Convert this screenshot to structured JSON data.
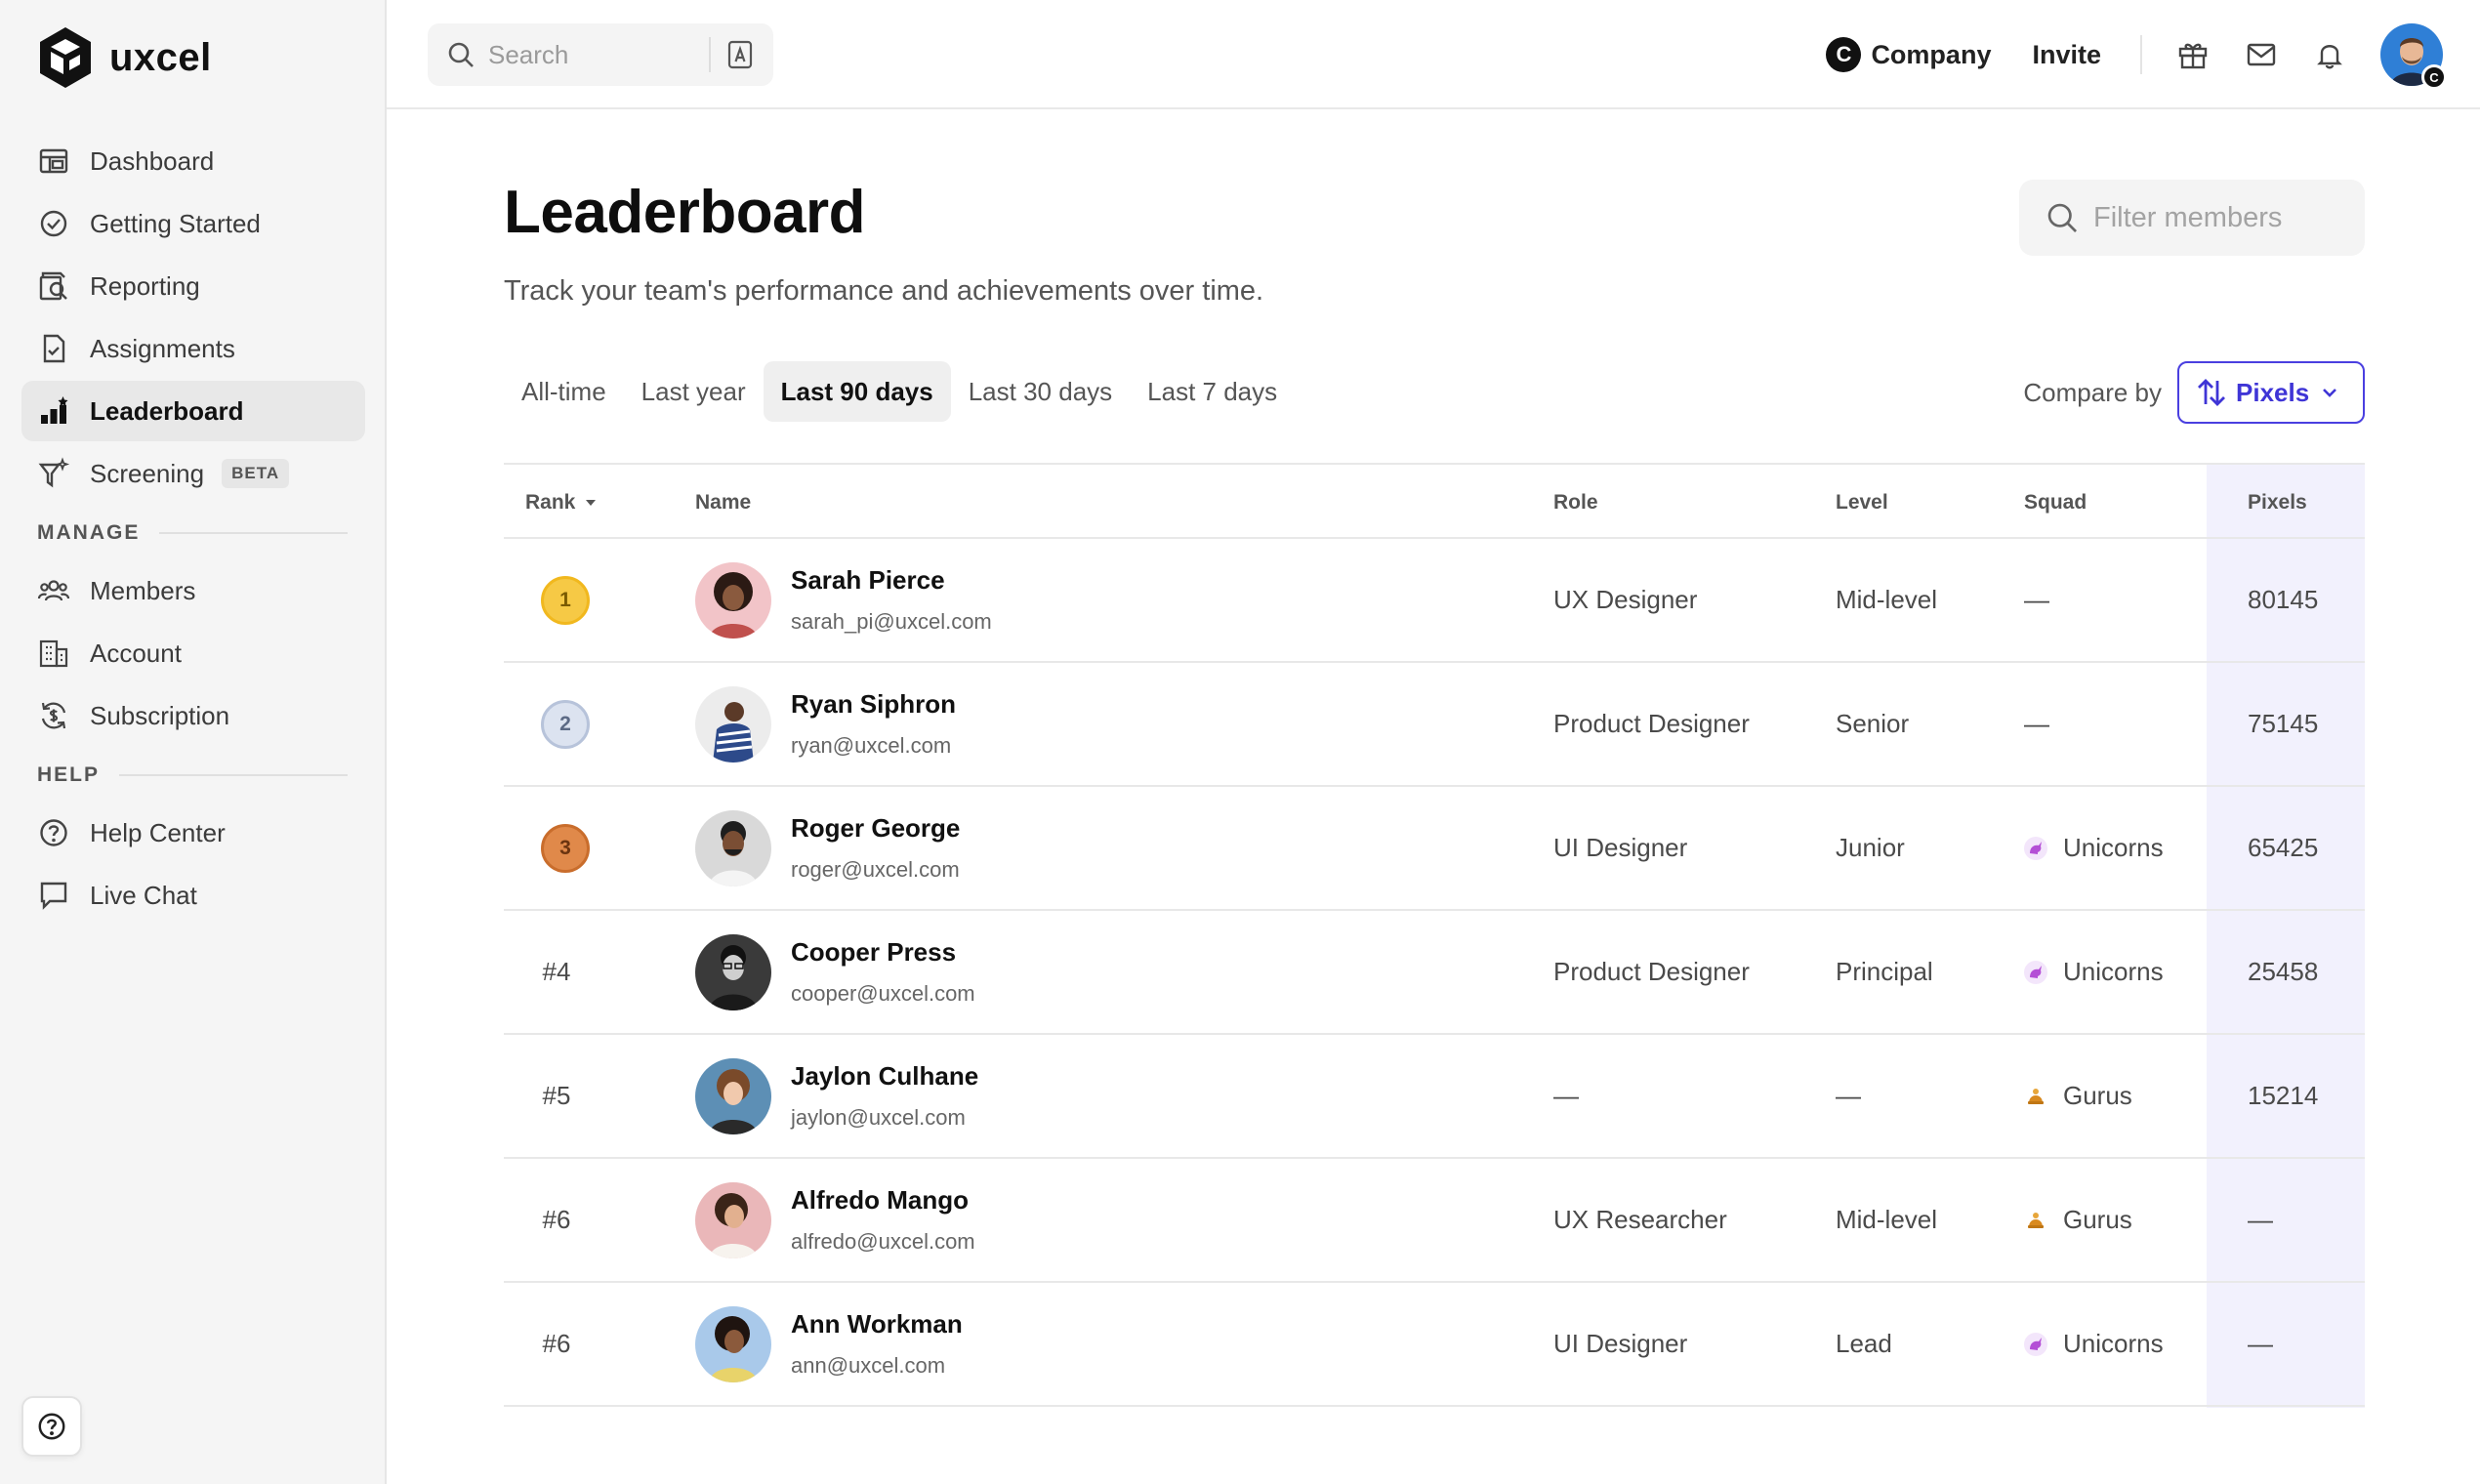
{
  "brand": {
    "name": "uxcel"
  },
  "sidebar": {
    "items": [
      {
        "label": "Dashboard",
        "icon": "dashboard-icon"
      },
      {
        "label": "Getting Started",
        "icon": "check-circle-icon"
      },
      {
        "label": "Reporting",
        "icon": "reporting-icon"
      },
      {
        "label": "Assignments",
        "icon": "assignment-icon"
      },
      {
        "label": "Leaderboard",
        "icon": "leaderboard-icon",
        "active": true
      },
      {
        "label": "Screening",
        "icon": "screening-icon",
        "badge": "BETA"
      }
    ],
    "manage_label": "MANAGE",
    "manage_items": [
      {
        "label": "Members",
        "icon": "members-icon"
      },
      {
        "label": "Account",
        "icon": "building-icon"
      },
      {
        "label": "Subscription",
        "icon": "subscription-icon"
      }
    ],
    "help_label": "HELP",
    "help_items": [
      {
        "label": "Help Center",
        "icon": "help-circle-icon"
      },
      {
        "label": "Live Chat",
        "icon": "chat-icon"
      }
    ]
  },
  "topbar": {
    "search_placeholder": "Search",
    "company_label": "Company",
    "company_initial": "C",
    "invite_label": "Invite",
    "avatar_badge": "C"
  },
  "page": {
    "title": "Leaderboard",
    "subtitle": "Track your team's performance and achievements over time.",
    "filter_placeholder": "Filter members",
    "tabs": [
      "All-time",
      "Last year",
      "Last 90 days",
      "Last 30 days",
      "Last 7 days"
    ],
    "active_tab": "Last 90 days",
    "compare_label": "Compare by",
    "compare_value": "Pixels"
  },
  "table": {
    "columns": {
      "rank": "Rank",
      "name": "Name",
      "role": "Role",
      "level": "Level",
      "squad": "Squad",
      "pixels": "Pixels"
    },
    "rows": [
      {
        "rank": "1",
        "name": "Sarah Pierce",
        "email": "sarah_pi@uxcel.com",
        "role": "UX Designer",
        "level": "Mid-level",
        "squad": "—",
        "pixels": "80145"
      },
      {
        "rank": "2",
        "name": "Ryan Siphron",
        "email": "ryan@uxcel.com",
        "role": "Product Designer",
        "level": "Senior",
        "squad": "—",
        "pixels": "75145"
      },
      {
        "rank": "3",
        "name": "Roger George",
        "email": "roger@uxcel.com",
        "role": "UI Designer",
        "level": "Junior",
        "squad": "Unicorns",
        "pixels": "65425"
      },
      {
        "rank": "#4",
        "name": "Cooper Press",
        "email": "cooper@uxcel.com",
        "role": "Product Designer",
        "level": "Principal",
        "squad": "Unicorns",
        "pixels": "25458"
      },
      {
        "rank": "#5",
        "name": "Jaylon Culhane",
        "email": "jaylon@uxcel.com",
        "role": "—",
        "level": "—",
        "squad": "Gurus",
        "pixels": "15214"
      },
      {
        "rank": "#6",
        "name": "Alfredo Mango",
        "email": "alfredo@uxcel.com",
        "role": "UX Researcher",
        "level": "Mid-level",
        "squad": "Gurus",
        "pixels": "—"
      },
      {
        "rank": "#6",
        "name": "Ann Workman",
        "email": "ann@uxcel.com",
        "role": "UI Designer",
        "level": "Lead",
        "squad": "Unicorns",
        "pixels": "—"
      }
    ]
  },
  "colors": {
    "accent": "#3f35d6",
    "gold": "#f6c945",
    "silver": "#c9d3e6",
    "bronze": "#e0894a",
    "pixels_column": "#f2f1fd"
  }
}
